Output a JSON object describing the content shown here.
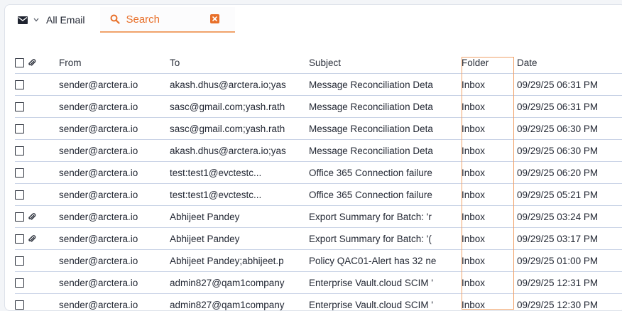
{
  "toolbar": {
    "folder_label": "All Email",
    "search_placeholder": "Search"
  },
  "columns": {
    "from": "From",
    "to": "To",
    "subject": "Subject",
    "folder": "Folder",
    "date": "Date"
  },
  "rows": [
    {
      "attachment": false,
      "from": "sender@arctera.io",
      "to": "akash.dhus@arctera.io;yas",
      "subject": "Message Reconciliation Deta",
      "folder": "Inbox",
      "date": "09/29/25 06:31 PM"
    },
    {
      "attachment": false,
      "from": "sender@arctera.io",
      "to": "sasc@gmail.com;yash.rath",
      "subject": "Message Reconciliation Deta",
      "folder": "Inbox",
      "date": "09/29/25 06:31 PM"
    },
    {
      "attachment": false,
      "from": "sender@arctera.io",
      "to": "sasc@gmail.com;yash.rath",
      "subject": "Message Reconciliation Deta",
      "folder": "Inbox",
      "date": "09/29/25 06:30 PM"
    },
    {
      "attachment": false,
      "from": "sender@arctera.io",
      "to": "akash.dhus@arctera.io;yas",
      "subject": "Message Reconciliation Deta",
      "folder": "Inbox",
      "date": "09/29/25 06:30 PM"
    },
    {
      "attachment": false,
      "from": "sender@arctera.io",
      "to": "test:test1@evctestc...",
      "subject": "Office 365 Connection failure",
      "folder": "Inbox",
      "date": "09/29/25 06:20 PM"
    },
    {
      "attachment": false,
      "from": "sender@arctera.io",
      "to": "test:test1@evctestc...",
      "subject": "Office 365 Connection failure",
      "folder": "Inbox",
      "date": "09/29/25 05:21 PM"
    },
    {
      "attachment": true,
      "from": "sender@arctera.io",
      "to": "Abhijeet Pandey",
      "subject": "Export Summary for Batch: 'r",
      "folder": "Inbox",
      "date": "09/29/25 03:24 PM"
    },
    {
      "attachment": true,
      "from": "sender@arctera.io",
      "to": "Abhijeet Pandey",
      "subject": "Export Summary for Batch: '(",
      "folder": "Inbox",
      "date": "09/29/25 03:17 PM"
    },
    {
      "attachment": false,
      "from": "sender@arctera.io",
      "to": "Abhijeet Pandey;abhijeet.p",
      "subject": "Policy QAC01-Alert has 32 ne",
      "folder": "Inbox",
      "date": "09/29/25 01:00 PM"
    },
    {
      "attachment": false,
      "from": "sender@arctera.io",
      "to": "admin827@qam1company",
      "subject": "Enterprise Vault.cloud SCIM '",
      "folder": "Inbox",
      "date": "09/29/25 12:31 PM"
    },
    {
      "attachment": false,
      "from": "sender@arctera.io",
      "to": "admin827@qam1company",
      "subject": "Enterprise Vault.cloud SCIM '",
      "folder": "Inbox",
      "date": "09/29/25 12:30 PM"
    }
  ],
  "icons": {
    "folder_icon": "envelope-icon",
    "dropdown_icon": "chevron-down-icon",
    "search_icon": "search-icon",
    "clear_icon": "close-icon",
    "attachment_icon": "paperclip-icon"
  },
  "colors": {
    "accent": "#e8702a",
    "highlight_border": "#f0a36b",
    "row_border": "#c9d3e6"
  }
}
